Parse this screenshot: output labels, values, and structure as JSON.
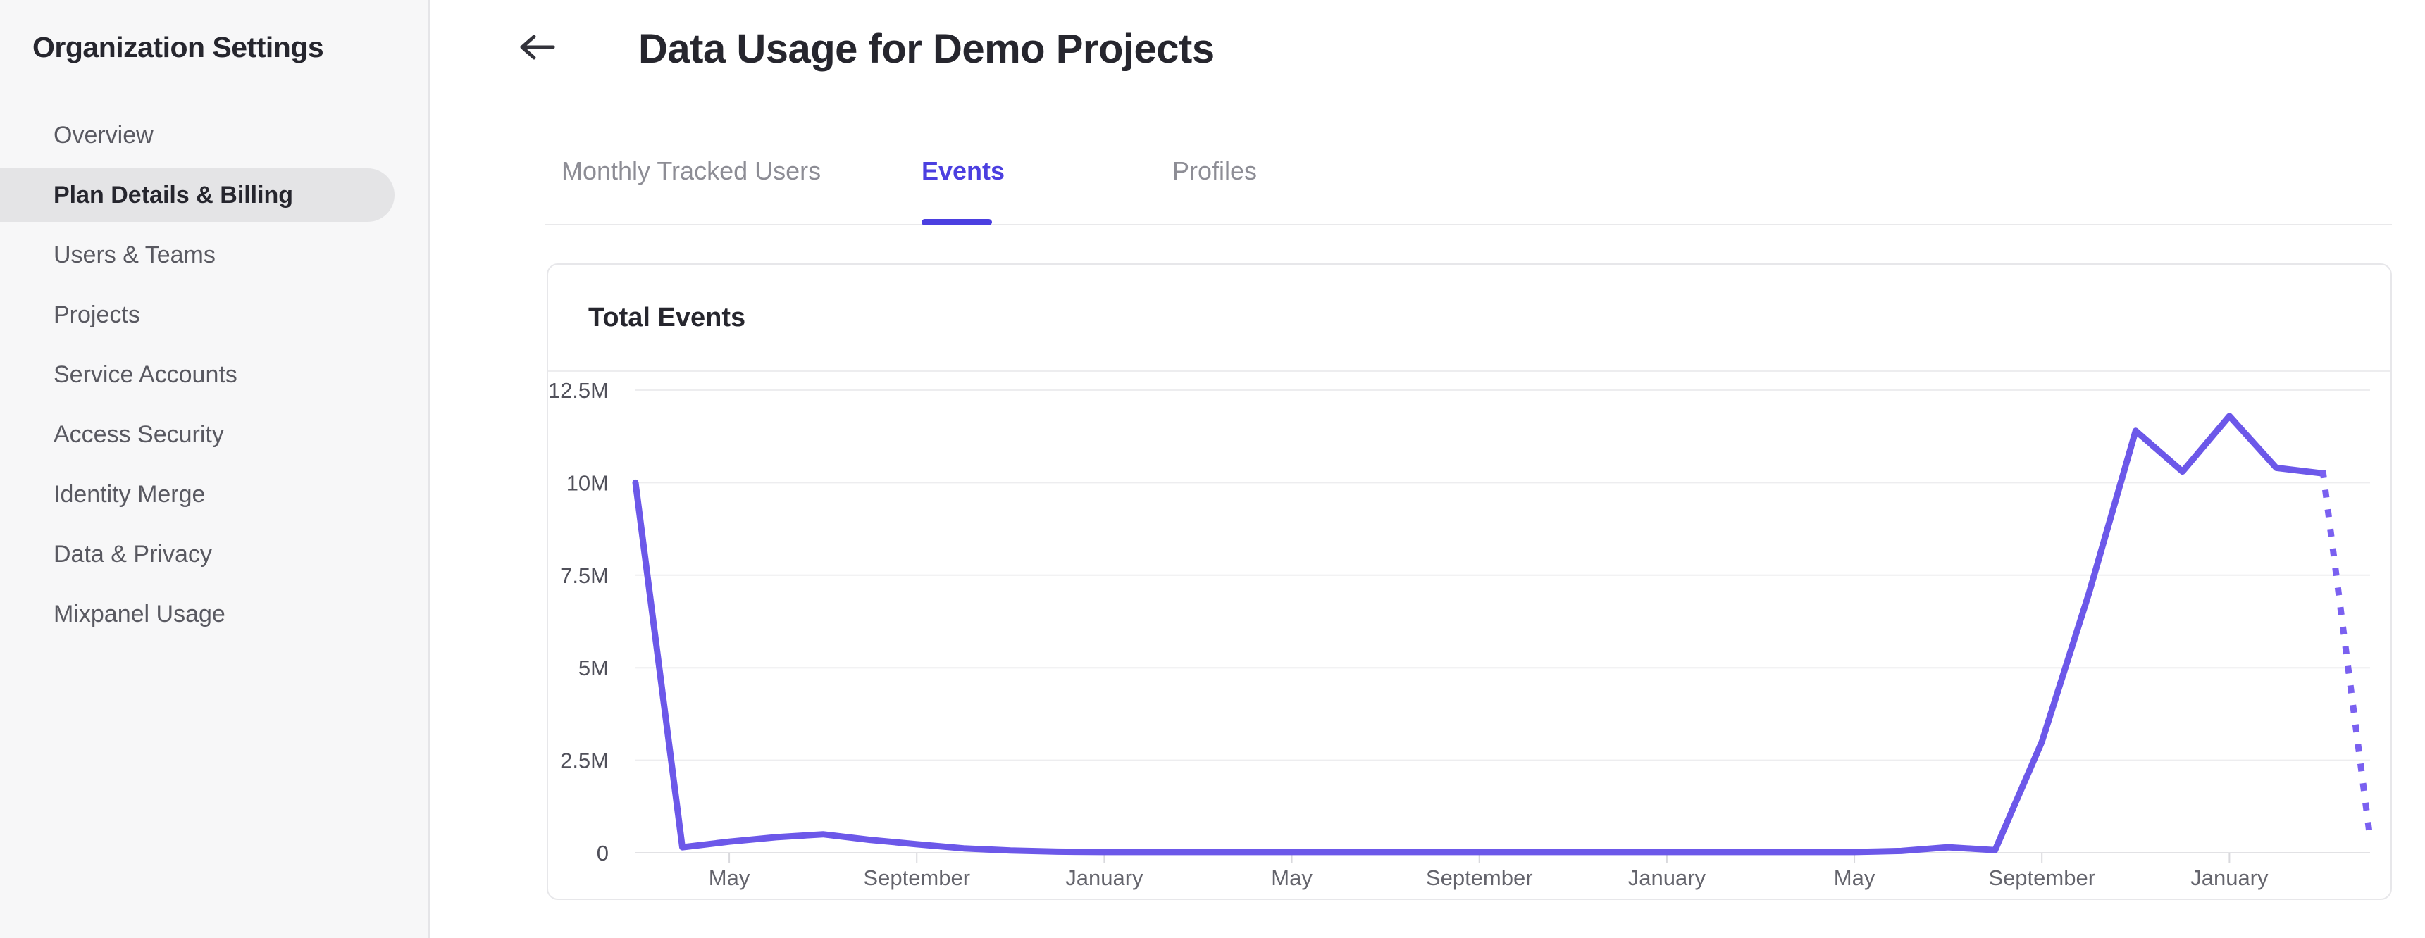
{
  "sidebar": {
    "title": "Organization Settings",
    "items": [
      {
        "label": "Overview",
        "active": false
      },
      {
        "label": "Plan Details & Billing",
        "active": true
      },
      {
        "label": "Users & Teams",
        "active": false
      },
      {
        "label": "Projects",
        "active": false
      },
      {
        "label": "Service Accounts",
        "active": false
      },
      {
        "label": "Access Security",
        "active": false
      },
      {
        "label": "Identity Merge",
        "active": false
      },
      {
        "label": "Data & Privacy",
        "active": false
      },
      {
        "label": "Mixpanel Usage",
        "active": false
      }
    ]
  },
  "header": {
    "title": "Data Usage for Demo Projects",
    "back_icon": "left-arrow-icon"
  },
  "tabs": [
    {
      "label": "Monthly Tracked Users",
      "active": false
    },
    {
      "label": "Events",
      "active": true
    },
    {
      "label": "Profiles",
      "active": false
    }
  ],
  "card": {
    "title": "Total Events"
  },
  "colors": {
    "accent": "#4B3FE0",
    "line": "#6C58E9",
    "line_projection": "#7A60F0",
    "sidebar_bg": "#F7F7F8",
    "active_pill": "#E4E4E6",
    "grid": "#EDEDEF",
    "axis": "#E2E2E5",
    "tick": "#D9D9DD",
    "y_label": "#50505A",
    "x_label": "#64646C"
  },
  "chart_data": {
    "type": "line",
    "title": "Total Events",
    "ylabel": "",
    "xlabel": "",
    "unit": "events (millions)",
    "ylim": [
      0,
      12.5
    ],
    "grid": "horizontal",
    "legend": "none",
    "y_ticks": [
      {
        "label": "12.5M",
        "value": 12.5
      },
      {
        "label": "10M",
        "value": 10
      },
      {
        "label": "7.5M",
        "value": 7.5
      },
      {
        "label": "5M",
        "value": 5
      },
      {
        "label": "2.5M",
        "value": 2.5
      },
      {
        "label": "0",
        "value": 0
      }
    ],
    "x_labels": [
      "May",
      "September",
      "January",
      "May",
      "September",
      "January",
      "May",
      "September",
      "January"
    ],
    "x_label_indices": [
      2,
      6,
      10,
      14,
      18,
      22,
      26,
      30,
      34
    ],
    "x_range_note": "monthly points, Mar year1 through Apr year3; final month is a dotted projection",
    "months": [
      {
        "m": "Mar",
        "v": 10.0
      },
      {
        "m": "Apr",
        "v": 0.15
      },
      {
        "m": "May",
        "v": 0.3
      },
      {
        "m": "Jun",
        "v": 0.42
      },
      {
        "m": "Jul",
        "v": 0.5
      },
      {
        "m": "Aug",
        "v": 0.35
      },
      {
        "m": "Sep",
        "v": 0.23
      },
      {
        "m": "Oct",
        "v": 0.12
      },
      {
        "m": "Nov",
        "v": 0.06
      },
      {
        "m": "Dec",
        "v": 0.03
      },
      {
        "m": "Jan",
        "v": 0.02
      },
      {
        "m": "Feb",
        "v": 0.02
      },
      {
        "m": "Mar",
        "v": 0.02
      },
      {
        "m": "Apr",
        "v": 0.02
      },
      {
        "m": "May",
        "v": 0.02
      },
      {
        "m": "Jun",
        "v": 0.02
      },
      {
        "m": "Jul",
        "v": 0.02
      },
      {
        "m": "Aug",
        "v": 0.02
      },
      {
        "m": "Sep",
        "v": 0.02
      },
      {
        "m": "Oct",
        "v": 0.02
      },
      {
        "m": "Nov",
        "v": 0.02
      },
      {
        "m": "Dec",
        "v": 0.02
      },
      {
        "m": "Jan",
        "v": 0.02
      },
      {
        "m": "Feb",
        "v": 0.02
      },
      {
        "m": "Mar",
        "v": 0.02
      },
      {
        "m": "Apr",
        "v": 0.02
      },
      {
        "m": "May",
        "v": 0.02
      },
      {
        "m": "Jun",
        "v": 0.05
      },
      {
        "m": "Jul",
        "v": 0.15
      },
      {
        "m": "Aug",
        "v": 0.07
      },
      {
        "m": "Sep",
        "v": 3.0
      },
      {
        "m": "Oct",
        "v": 7.0
      },
      {
        "m": "Nov",
        "v": 11.4
      },
      {
        "m": "Dec",
        "v": 10.3
      },
      {
        "m": "Jan",
        "v": 11.8
      },
      {
        "m": "Feb",
        "v": 10.4
      },
      {
        "m": "Mar",
        "v": 10.25
      },
      {
        "m": "Apr",
        "v": 0.4,
        "projected": true
      }
    ]
  }
}
